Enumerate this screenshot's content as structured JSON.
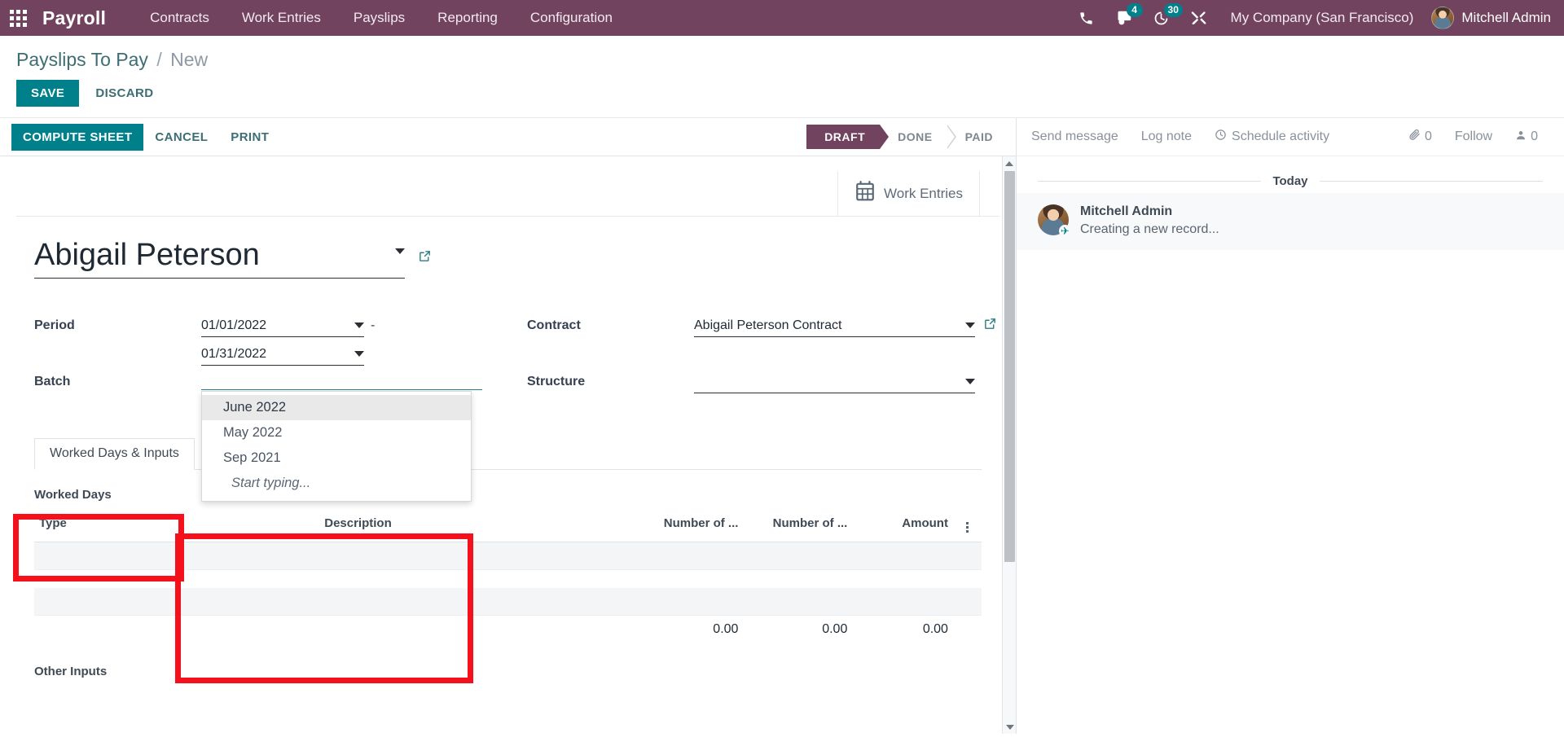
{
  "navbar": {
    "apps_icon": "grid-apps-icon",
    "brand": "Payroll",
    "menus": [
      "Contracts",
      "Work Entries",
      "Payslips",
      "Reporting",
      "Configuration"
    ],
    "icons": [
      {
        "name": "phone-icon",
        "badge": null
      },
      {
        "name": "messages-icon",
        "badge": "4"
      },
      {
        "name": "activities-clock-icon",
        "badge": "30"
      },
      {
        "name": "debug-tools-icon",
        "badge": null
      }
    ],
    "company": "My Company (San Francisco)",
    "user": "Mitchell Admin"
  },
  "control_panel": {
    "breadcrumb_root": "Payslips To Pay",
    "breadcrumb_sep": "/",
    "breadcrumb_current": "New",
    "save_label": "SAVE",
    "discard_label": "DISCARD"
  },
  "form": {
    "buttons": {
      "compute_sheet": "COMPUTE SHEET",
      "cancel": "CANCEL",
      "print": "PRINT"
    },
    "statusbar": [
      {
        "label": "DRAFT",
        "active": true
      },
      {
        "label": "DONE",
        "active": false
      },
      {
        "label": "PAID",
        "active": false
      }
    ],
    "stat_button": {
      "icon": "calendar-icon",
      "label": "Work Entries"
    },
    "title": "Abigail Peterson",
    "fields": {
      "period_label": "Period",
      "period_from": "01/01/2022",
      "period_dash": "-",
      "period_to": "01/31/2022",
      "batch_label": "Batch",
      "batch_value": "",
      "contract_label": "Contract",
      "contract_value": "Abigail Peterson Contract",
      "structure_label": "Structure",
      "structure_value": ""
    },
    "batch_dropdown": {
      "options": [
        "June 2022",
        "May 2022",
        "Sep 2021"
      ],
      "active_index": 0,
      "hint": "Start typing..."
    },
    "notebook": {
      "tabs": [
        "Worked Days & Inputs"
      ],
      "active_tab": 0,
      "worked_days_heading": "Worked Days",
      "other_inputs_heading": "Other Inputs",
      "table": {
        "columns": [
          "Type",
          "Description",
          "Number of ...",
          "Number of ...",
          "Amount"
        ],
        "options_icon": "column-options-icon",
        "rows": [],
        "totals": [
          "0.00",
          "0.00",
          "0.00"
        ]
      }
    }
  },
  "chatter": {
    "send_message": "Send message",
    "log_note": "Log note",
    "schedule_activity": "Schedule activity",
    "schedule_icon": "clock-icon",
    "attachment_icon": "paperclip-icon",
    "attachment_count": "0",
    "follow_label": "Follow",
    "followers_icon": "user-icon",
    "followers_count": "0",
    "day_separator": "Today",
    "messages": [
      {
        "author": "Mitchell Admin",
        "body": "Creating a new record...",
        "avatar": "user-avatar",
        "badge_icon": "paper-plane-icon"
      }
    ]
  },
  "colors": {
    "navbar_purple": "#71435f",
    "accent_teal": "#00808a",
    "annotation_red": "#f5111b",
    "breadcrumb_teal": "#3c6e74"
  }
}
